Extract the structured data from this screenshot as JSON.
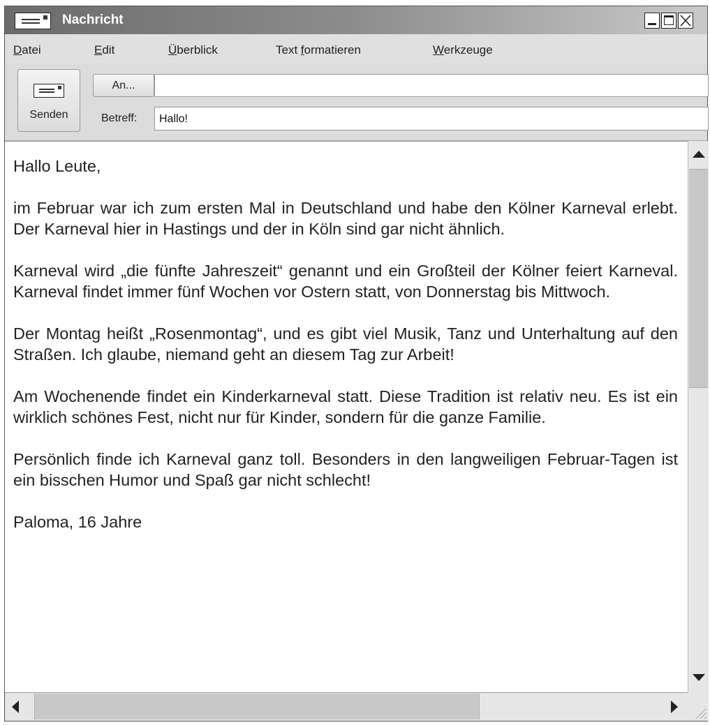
{
  "window": {
    "title": "Nachricht"
  },
  "menu": {
    "items": [
      {
        "label": "Datei",
        "mnemonic_index": 0
      },
      {
        "label": "Edit",
        "mnemonic_index": 0
      },
      {
        "label": "Überblick",
        "mnemonic_index": 0
      },
      {
        "label": "Text formatieren",
        "mnemonic_index": 5
      },
      {
        "label": "Werkzeuge",
        "mnemonic_index": 0
      }
    ]
  },
  "toolbar": {
    "send_label": "Senden",
    "to_button_label": "An...",
    "to_value": "",
    "subject_label": "Betreff:",
    "subject_value": "Hallo!"
  },
  "message": {
    "paragraphs": [
      "Hallo Leute,",
      "im Februar war ich zum ersten Mal in Deutschland und habe den Kölner Karneval erlebt. Der Karneval hier in Hastings und der in Köln sind gar nicht ähnlich.",
      "Karneval wird „die fünfte Jahreszeit“ genannt und ein Großteil der Kölner feiert Karneval. Karneval findet immer fünf Wochen vor Ostern statt, von Donnerstag bis Mittwoch.",
      "Der Montag heißt „Rosenmontag“, und es gibt viel Musik, Tanz und Unterhaltung auf den Straßen. Ich glaube, niemand geht an diesem Tag zur Arbeit!",
      "Am Wochenende findet ein Kinderkarneval statt. Diese Tradition ist relativ neu. Es ist ein wirklich schönes Fest, nicht nur für Kinder, sondern für die ganze Familie.",
      "Persönlich finde ich Karneval ganz toll. Besonders in den langweiligen Februar-Tagen ist ein bisschen Humor und Spaß gar nicht schlecht!",
      "Paloma, 16 Jahre"
    ]
  },
  "icons": {
    "title_icon": "envelope-icon",
    "send_icon": "envelope-icon",
    "minimize": "minimize-icon",
    "maximize": "maximize-icon",
    "close": "close-icon"
  },
  "colors": {
    "titlebar_start": "#6b6b6b",
    "titlebar_end": "#c9c9c9",
    "chrome": "#d4d4d4"
  }
}
